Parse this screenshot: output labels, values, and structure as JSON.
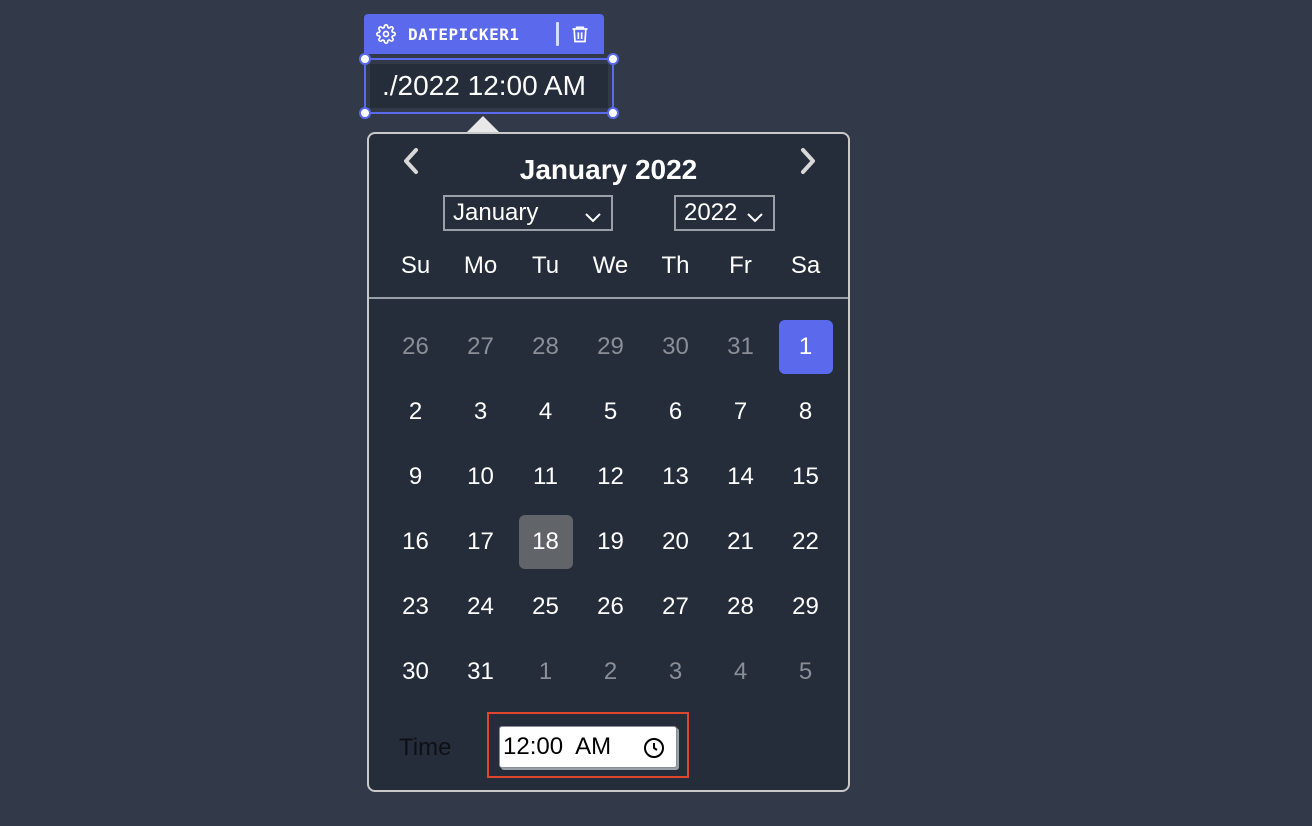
{
  "widget": {
    "name": "DATEPICKER1",
    "input_value": "./2022 12:00 AM"
  },
  "calendar": {
    "title": "January 2022",
    "month_select": "January",
    "year_select": "2022",
    "weekdays": [
      "Su",
      "Mo",
      "Tu",
      "We",
      "Th",
      "Fr",
      "Sa"
    ],
    "weeks": [
      [
        "26",
        "27",
        "28",
        "29",
        "30",
        "31",
        "1"
      ],
      [
        "2",
        "3",
        "4",
        "5",
        "6",
        "7",
        "8"
      ],
      [
        "9",
        "10",
        "11",
        "12",
        "13",
        "14",
        "15"
      ],
      [
        "16",
        "17",
        "18",
        "19",
        "20",
        "21",
        "22"
      ],
      [
        "23",
        "24",
        "25",
        "26",
        "27",
        "28",
        "29"
      ],
      [
        "30",
        "31",
        "1",
        "2",
        "3",
        "4",
        "5"
      ]
    ],
    "muted_cells": [
      "0-0",
      "0-1",
      "0-2",
      "0-3",
      "0-4",
      "0-5",
      "5-2",
      "5-3",
      "5-4",
      "5-5",
      "5-6"
    ],
    "selected_cell": "0-6",
    "today_cell": "3-2",
    "time_label": "Time",
    "time_value": "12:00  AM"
  },
  "colors": {
    "accent": "#5b6aec",
    "background": "#323a4a",
    "panel": "#252d3a",
    "highlight_today": "#616469",
    "time_outline": "#e0452e"
  },
  "icons": {
    "settings": "gear-icon",
    "delete": "trash-icon",
    "prev": "chevron-left-icon",
    "next": "chevron-right-icon",
    "dropdown": "chevron-down-icon",
    "clock": "clock-icon"
  }
}
